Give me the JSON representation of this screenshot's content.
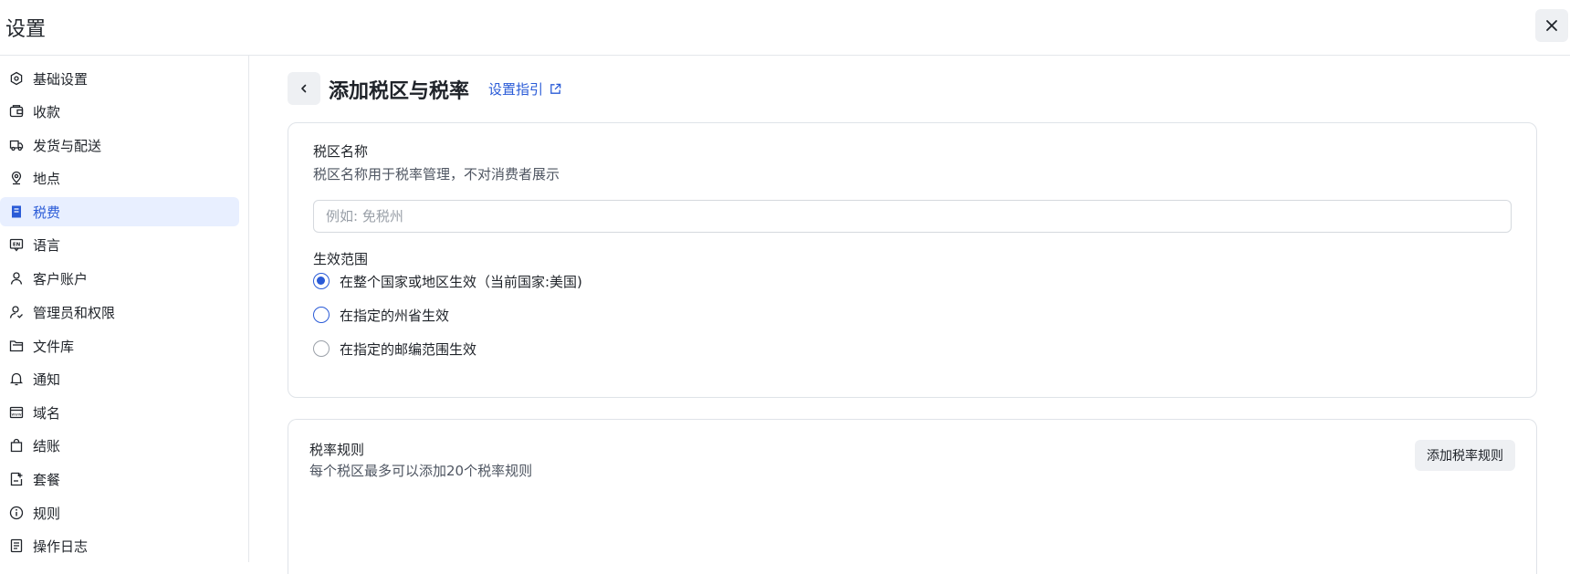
{
  "header": {
    "title": "设置",
    "close_icon": "close-icon"
  },
  "sidebar": {
    "items": [
      {
        "label": "基础设置",
        "icon": "settings-hex-icon"
      },
      {
        "label": "收款",
        "icon": "wallet-icon"
      },
      {
        "label": "发货与配送",
        "icon": "truck-icon"
      },
      {
        "label": "地点",
        "icon": "location-pin-icon"
      },
      {
        "label": "税费",
        "icon": "tax-receipt-icon",
        "active": true
      },
      {
        "label": "语言",
        "icon": "language-en-icon"
      },
      {
        "label": "客户账户",
        "icon": "user-icon"
      },
      {
        "label": "管理员和权限",
        "icon": "user-check-icon"
      },
      {
        "label": "文件库",
        "icon": "folder-icon"
      },
      {
        "label": "通知",
        "icon": "bell-icon"
      },
      {
        "label": "域名",
        "icon": "domain-icon"
      },
      {
        "label": "结账",
        "icon": "shopping-bag-icon"
      },
      {
        "label": "套餐",
        "icon": "plan-icon"
      },
      {
        "label": "规则",
        "icon": "info-icon"
      },
      {
        "label": "操作日志",
        "icon": "log-icon"
      }
    ]
  },
  "page": {
    "title": "添加税区与税率",
    "guide_link": "设置指引"
  },
  "tax_zone": {
    "name_label": "税区名称",
    "name_help": "税区名称用于税率管理，不对消费者展示",
    "name_placeholder": "例如: 免税州",
    "name_value": "",
    "scope_label": "生效范围",
    "scope_options": [
      {
        "label": "在整个国家或地区生效（当前国家:美国)",
        "selected": true
      },
      {
        "label": "在指定的州省生效",
        "selected": false
      },
      {
        "label": "在指定的邮编范围生效",
        "selected": false
      }
    ]
  },
  "tax_rules": {
    "title": "税率规则",
    "help": "每个税区最多可以添加20个税率规则",
    "add_button": "添加税率规则"
  },
  "colors": {
    "accent": "#2a5bd7",
    "active_bg": "#e8efff"
  }
}
